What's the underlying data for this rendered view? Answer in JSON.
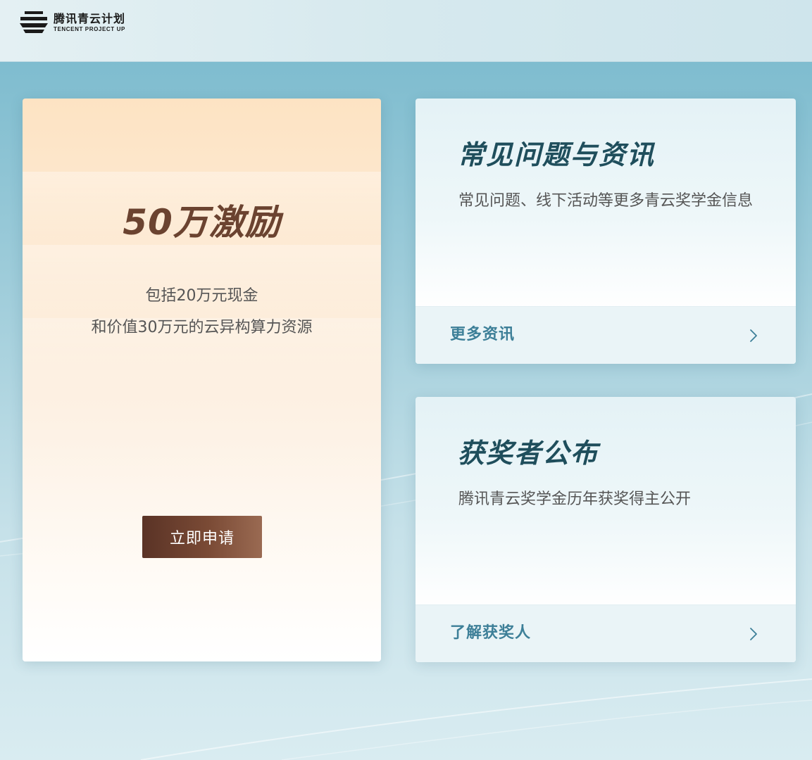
{
  "header": {
    "logo_cn": "腾讯青云计划",
    "logo_en": "TENCENT PROJECT UP",
    "logo_icon": "tencent-project-up-logo-icon"
  },
  "reward_card": {
    "title": "50万激励",
    "line1": "包括20万元现金",
    "line2": "和价值30万元的云异构算力资源",
    "apply_label": "立即申请"
  },
  "faq_card": {
    "title": "常见问题与资讯",
    "description": "常见问题、线下活动等更多青云奖学金信息",
    "link_label": "更多资讯",
    "link_icon": "chevron-right-icon"
  },
  "winners_card": {
    "title": "获奖者公布",
    "description": "腾讯青云奖学金历年获奖得主公开",
    "link_label": "了解获奖人",
    "link_icon": "chevron-right-icon"
  },
  "colors": {
    "brand_brown": "#6b4330",
    "button_start": "#5a3326",
    "button_end": "#9a6a52",
    "teal_title": "#1f4e5c",
    "link_blue": "#3d7f98"
  }
}
